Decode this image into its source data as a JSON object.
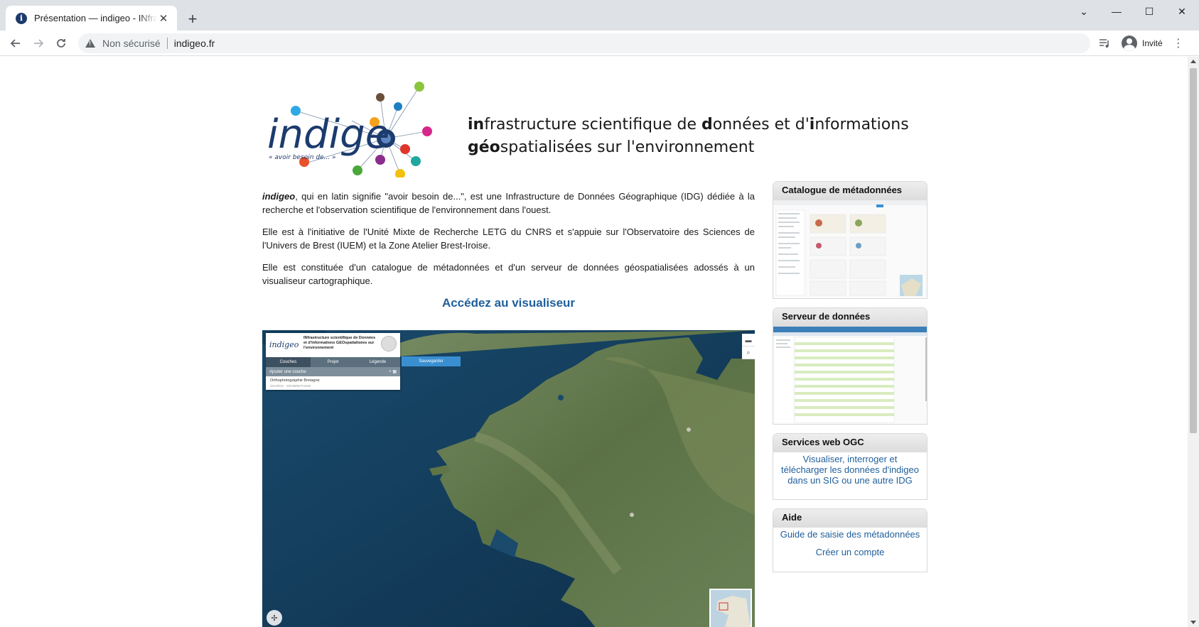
{
  "browser": {
    "tab_title": "Présentation — indigeo - INfrastructure scientifique",
    "new_tab": "+",
    "security_label": "Non sécurisé",
    "url": "indigeo.fr",
    "profile_label": "Invité",
    "window_controls": {
      "minimize": "—",
      "maximize": "☐",
      "close": "✕",
      "tab_search": "⌄"
    }
  },
  "header": {
    "logo_text": "indige",
    "logo_subtitle": "« avoir besoin de... »",
    "tagline": {
      "line1": [
        {
          "b": "in"
        },
        {
          "t": "frastructure scientifique de "
        },
        {
          "b": "d"
        },
        {
          "t": "onnées et d'"
        },
        {
          "b": "i"
        },
        {
          "t": "nformations"
        }
      ],
      "line2": [
        {
          "b": "géo"
        },
        {
          "t": "spatialisées sur l'environnement"
        }
      ]
    }
  },
  "intro": {
    "p1_name": "indigeo",
    "p1_rest": ", qui en latin signifie \"avoir besoin de...\", est une Infrastructure de Données Géographique (IDG) dédiée à la recherche et l'observation scientifique de l'environnement dans l'ouest.",
    "p2": "Elle est à l'initiative de l'Unité Mixte de Recherche LETG du CNRS et s'appuie sur l'Observatoire des Sciences de l'Univers de Brest (IUEM) et la Zone Atelier Brest-Iroise.",
    "p3": "Elle est constituée d'un catalogue de métadonnées et d'un serveur de données géospatialisées adossés à un visualiseur cartographique.",
    "viewer_link": "Accédez au visualiseur"
  },
  "viewer": {
    "panel_logo": "indigeo",
    "panel_title": "INfrastructure scientifique de Données et d'Informations GEOspatialisées sur l'environnement",
    "tabs": [
      "Couches",
      "Projet",
      "Légende"
    ],
    "add_layer": "Ajouter une couche",
    "layer_name": "Orthophotographie Bretagne",
    "layer_source": "SOURCE : GEOBRETAGNE",
    "save_button": "Sauvegarder"
  },
  "side": {
    "catalogue": {
      "title": "Catalogue de métadonnées"
    },
    "server": {
      "title": "Serveur de données"
    },
    "ogc": {
      "title": "Services web OGC",
      "link": "Visualiser, interroger et télécharger les données d'indigeo dans un SIG ou une autre IDG"
    },
    "help": {
      "title": "Aide",
      "link1": "Guide de saisie des métadonnées",
      "link2": "Créer un compte"
    }
  }
}
